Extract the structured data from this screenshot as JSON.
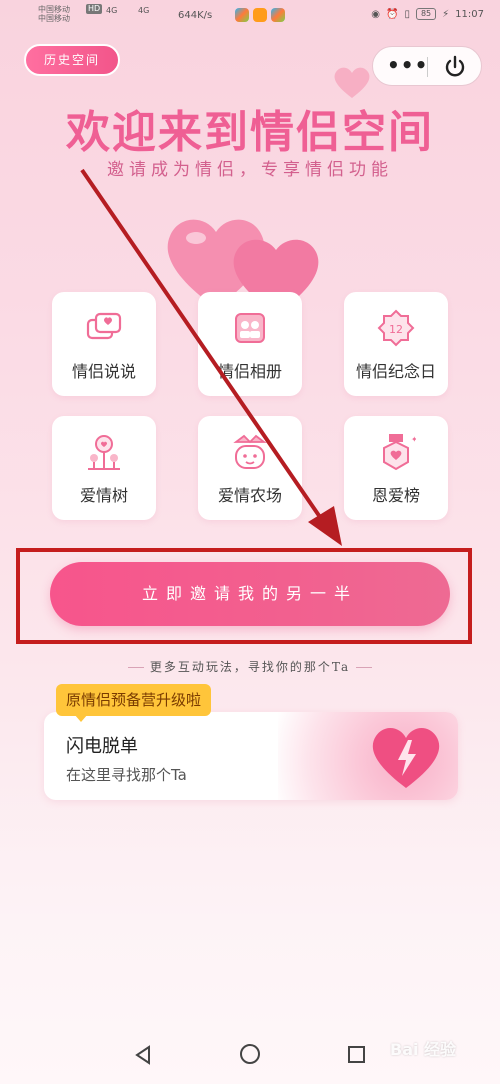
{
  "status_bar": {
    "carrier_line1": "中国移动",
    "carrier_line2": "中国移动",
    "hd1": "HD",
    "net1": "4G",
    "net2": "4G",
    "speed": "644K/s",
    "battery": "85",
    "time": "11:07"
  },
  "header": {
    "history_label": "历史空间",
    "more_label": "•••"
  },
  "hero": {
    "title": "欢迎来到情侣空间",
    "subtitle": "邀请成为情侣，专享情侣功能"
  },
  "features": [
    {
      "label": "情侣说说",
      "icon": "chat-bubbles-icon"
    },
    {
      "label": "情侣相册",
      "icon": "photo-album-icon"
    },
    {
      "label": "情侣纪念日",
      "icon": "anniversary-badge-icon"
    },
    {
      "label": "爱情树",
      "icon": "love-tree-icon"
    },
    {
      "label": "爱情农场",
      "icon": "farm-icon"
    },
    {
      "label": "恩爱榜",
      "icon": "medal-icon"
    }
  ],
  "cta": {
    "label": "立即邀请我的另一半"
  },
  "more_play": "更多互动玩法，寻找你的那个Ta",
  "promo": {
    "badge": "原情侣预备营升级啦",
    "name": "闪电脱单",
    "desc": "在这里寻找那个Ta"
  },
  "watermark": "Bai 经验",
  "colors": {
    "accent": "#f2558a",
    "annotation": "#c51d1d",
    "badge": "#ffc53a"
  }
}
